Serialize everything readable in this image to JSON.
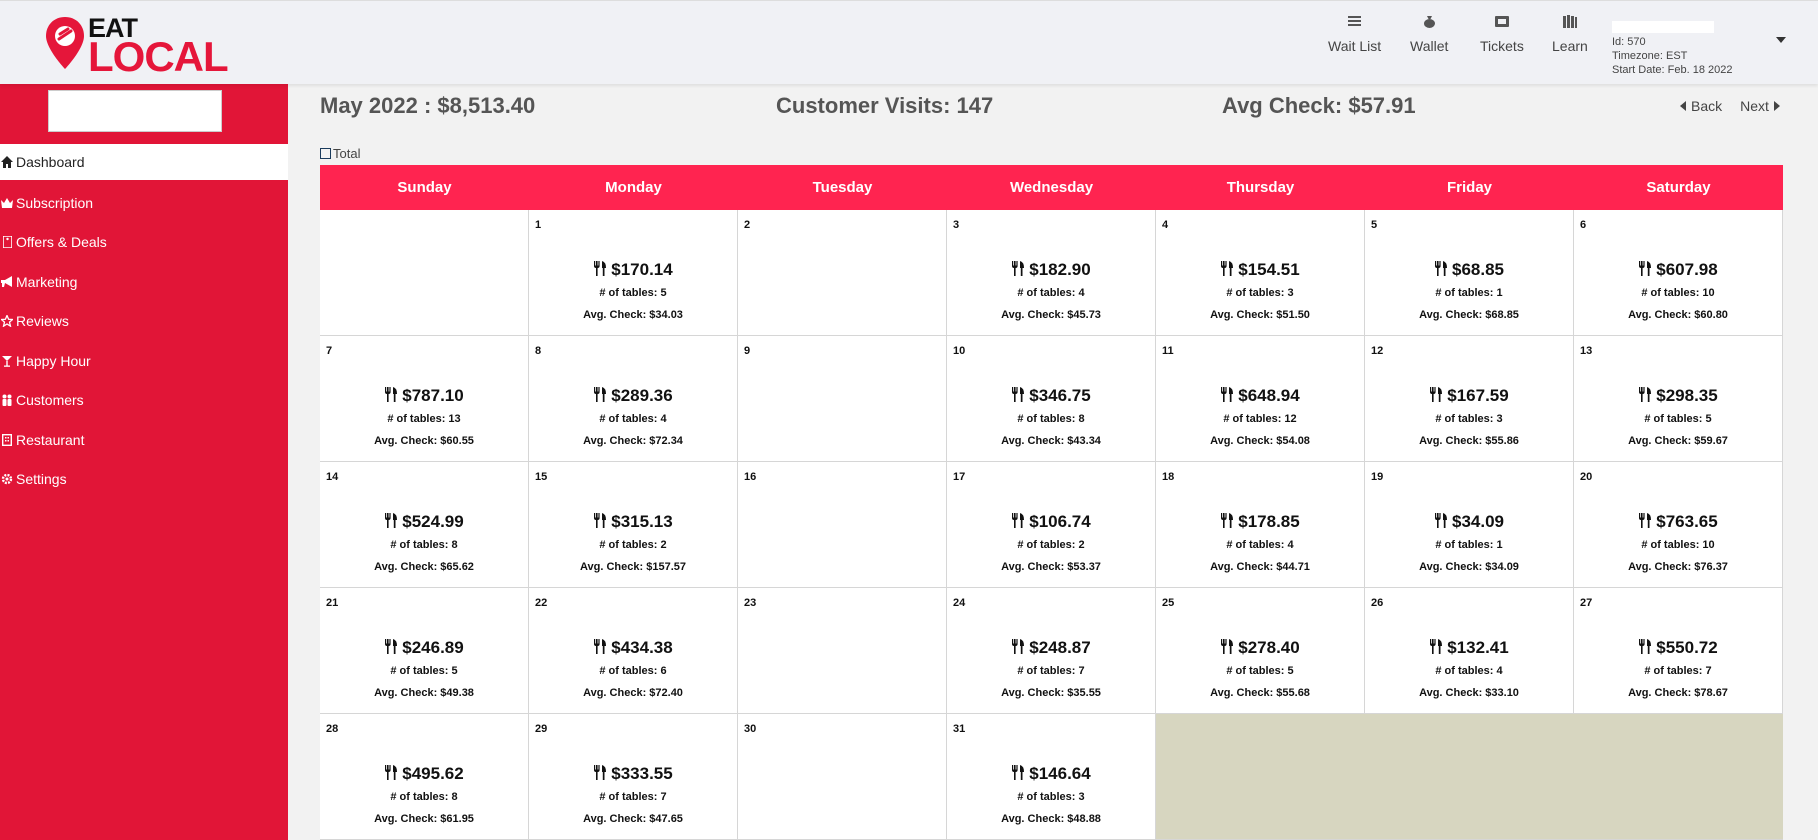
{
  "brand": {
    "line1": "EAT",
    "line2": "LOCAL",
    "color": "#e5163a"
  },
  "nav": [
    {
      "label": "Wait List",
      "icon": "list-icon"
    },
    {
      "label": "Wallet",
      "icon": "money-bag-icon"
    },
    {
      "label": "Tickets",
      "icon": "ticket-icon"
    },
    {
      "label": "Learn",
      "icon": "books-icon"
    }
  ],
  "account": {
    "id": "Id: 570",
    "timezone": "Timezone: EST",
    "start_date": "Start Date: Feb. 18 2022"
  },
  "sidebar": {
    "color": "#e11537",
    "items": [
      {
        "label": "Dashboard",
        "icon": "home-icon",
        "active": true
      },
      {
        "label": "Subscription",
        "icon": "crown-icon"
      },
      {
        "label": "Offers & Deals",
        "icon": "tag-icon"
      },
      {
        "label": "Marketing",
        "icon": "megaphone-icon"
      },
      {
        "label": "Reviews",
        "icon": "star-icon"
      },
      {
        "label": "Happy Hour",
        "icon": "cocktail-icon"
      },
      {
        "label": "Customers",
        "icon": "users-icon"
      },
      {
        "label": "Restaurant",
        "icon": "building-icon"
      },
      {
        "label": "Settings",
        "icon": "gear-icon"
      }
    ]
  },
  "summary": {
    "month_total": "May 2022 : $8,513.40",
    "visits": "Customer Visits: 147",
    "avg_check": "Avg Check: $57.91"
  },
  "pager": {
    "back": "Back",
    "next": "Next"
  },
  "total_toggle": "Total",
  "calendar": {
    "header_color": "#ff2450",
    "days": [
      "Sunday",
      "Monday",
      "Tuesday",
      "Wednesday",
      "Thursday",
      "Friday",
      "Saturday"
    ],
    "cells": [
      {
        "day": "",
        "amount": "",
        "tables": "",
        "avg": ""
      },
      {
        "day": "1",
        "amount": "$170.14",
        "tables": "# of tables: 5",
        "avg": "Avg. Check: $34.03"
      },
      {
        "day": "2",
        "amount": "",
        "tables": "",
        "avg": ""
      },
      {
        "day": "3",
        "amount": "$182.90",
        "tables": "# of tables: 4",
        "avg": "Avg. Check: $45.73"
      },
      {
        "day": "4",
        "amount": "$154.51",
        "tables": "# of tables: 3",
        "avg": "Avg. Check: $51.50"
      },
      {
        "day": "5",
        "amount": "$68.85",
        "tables": "# of tables: 1",
        "avg": "Avg. Check: $68.85"
      },
      {
        "day": "6",
        "amount": "$607.98",
        "tables": "# of tables: 10",
        "avg": "Avg. Check: $60.80"
      },
      {
        "day": "7",
        "amount": "$787.10",
        "tables": "# of tables: 13",
        "avg": "Avg. Check: $60.55"
      },
      {
        "day": "8",
        "amount": "$289.36",
        "tables": "# of tables: 4",
        "avg": "Avg. Check: $72.34"
      },
      {
        "day": "9",
        "amount": "",
        "tables": "",
        "avg": ""
      },
      {
        "day": "10",
        "amount": "$346.75",
        "tables": "# of tables: 8",
        "avg": "Avg. Check: $43.34"
      },
      {
        "day": "11",
        "amount": "$648.94",
        "tables": "# of tables: 12",
        "avg": "Avg. Check: $54.08"
      },
      {
        "day": "12",
        "amount": "$167.59",
        "tables": "# of tables: 3",
        "avg": "Avg. Check: $55.86"
      },
      {
        "day": "13",
        "amount": "$298.35",
        "tables": "# of tables: 5",
        "avg": "Avg. Check: $59.67"
      },
      {
        "day": "14",
        "amount": "$524.99",
        "tables": "# of tables: 8",
        "avg": "Avg. Check: $65.62"
      },
      {
        "day": "15",
        "amount": "$315.13",
        "tables": "# of tables: 2",
        "avg": "Avg. Check: $157.57"
      },
      {
        "day": "16",
        "amount": "",
        "tables": "",
        "avg": ""
      },
      {
        "day": "17",
        "amount": "$106.74",
        "tables": "# of tables: 2",
        "avg": "Avg. Check: $53.37"
      },
      {
        "day": "18",
        "amount": "$178.85",
        "tables": "# of tables: 4",
        "avg": "Avg. Check: $44.71"
      },
      {
        "day": "19",
        "amount": "$34.09",
        "tables": "# of tables: 1",
        "avg": "Avg. Check: $34.09"
      },
      {
        "day": "20",
        "amount": "$763.65",
        "tables": "# of tables: 10",
        "avg": "Avg. Check: $76.37"
      },
      {
        "day": "21",
        "amount": "$246.89",
        "tables": "# of tables: 5",
        "avg": "Avg. Check: $49.38"
      },
      {
        "day": "22",
        "amount": "$434.38",
        "tables": "# of tables: 6",
        "avg": "Avg. Check: $72.40"
      },
      {
        "day": "23",
        "amount": "",
        "tables": "",
        "avg": ""
      },
      {
        "day": "24",
        "amount": "$248.87",
        "tables": "# of tables: 7",
        "avg": "Avg. Check: $35.55"
      },
      {
        "day": "25",
        "amount": "$278.40",
        "tables": "# of tables: 5",
        "avg": "Avg. Check: $55.68"
      },
      {
        "day": "26",
        "amount": "$132.41",
        "tables": "# of tables: 4",
        "avg": "Avg. Check: $33.10"
      },
      {
        "day": "27",
        "amount": "$550.72",
        "tables": "# of tables: 7",
        "avg": "Avg. Check: $78.67"
      },
      {
        "day": "28",
        "amount": "$495.62",
        "tables": "# of tables: 8",
        "avg": "Avg. Check: $61.95"
      },
      {
        "day": "29",
        "amount": "$333.55",
        "tables": "# of tables: 7",
        "avg": "Avg. Check: $47.65"
      },
      {
        "day": "30",
        "amount": "",
        "tables": "",
        "avg": ""
      },
      {
        "day": "31",
        "amount": "$146.64",
        "tables": "# of tables: 3",
        "avg": "Avg. Check: $48.88"
      }
    ],
    "trailing_fill_color": "#d7d6c0"
  }
}
